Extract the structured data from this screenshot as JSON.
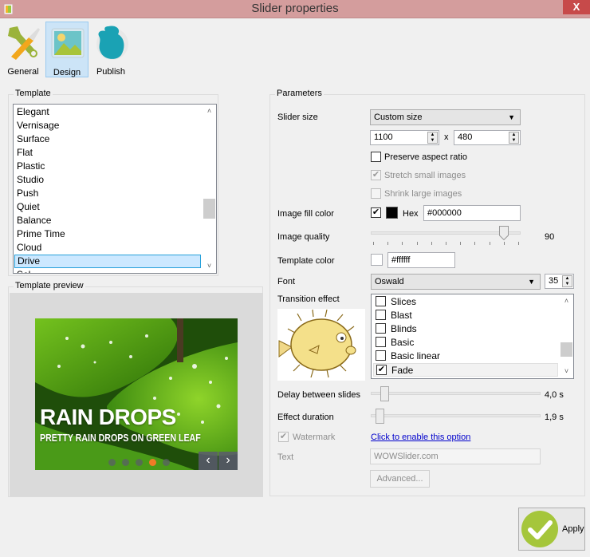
{
  "window": {
    "title": "Slider properties",
    "close_label": "X"
  },
  "toolbar": {
    "buttons": [
      {
        "label": "General",
        "icon": "wrench-icon",
        "active": false
      },
      {
        "label": "Design",
        "icon": "image-icon",
        "active": true
      },
      {
        "label": "Publish",
        "icon": "publish-icon",
        "active": false
      }
    ]
  },
  "template_group": {
    "title": "Template",
    "items": [
      "Elegant",
      "Vernisage",
      "Surface",
      "Flat",
      "Plastic",
      "Studio",
      "Push",
      "Quiet",
      "Balance",
      "Prime Time",
      "Cloud",
      "Drive",
      "Sol"
    ],
    "selected": "Drive",
    "scroll_up": "˄",
    "scroll_down": "˅"
  },
  "preview_group": {
    "title": "Template preview",
    "headline": "RAIN DROPS",
    "subtitle": "PRETTY RAIN DROPS ON GREEN LEAF",
    "dots_count": 5,
    "active_dot": 4,
    "prev_label": "‹",
    "next_label": "›",
    "colors": {
      "active_dot": "#f07b26"
    }
  },
  "parameters": {
    "title": "Parameters",
    "slider_size": {
      "label": "Slider size",
      "selected": "Custom size",
      "width": "1100",
      "times": "x",
      "height": "480"
    },
    "preserve_aspect": {
      "label": "Preserve aspect ratio",
      "checked": false
    },
    "stretch_small": {
      "label": "Stretch small images",
      "checked": true,
      "disabled": true
    },
    "shrink_large": {
      "label": "Shrink large images",
      "checked": false,
      "disabled": true
    },
    "image_fill": {
      "label": "Image fill color",
      "checked": true,
      "hex_label": "Hex",
      "hex_value": "#000000",
      "swatch": "#000000"
    },
    "image_quality": {
      "label": "Image quality",
      "value": 90,
      "value_text": "90",
      "min": 0,
      "max": 100
    },
    "template_color": {
      "label": "Template color",
      "value": "#ffffff",
      "swatch": "#ffffff"
    },
    "font": {
      "label": "Font",
      "selected": "Oswald",
      "size": "35"
    },
    "transition": {
      "label": "Transition effect",
      "items": [
        {
          "label": "Slices",
          "checked": false
        },
        {
          "label": "Blast",
          "checked": false
        },
        {
          "label": "Blinds",
          "checked": false
        },
        {
          "label": "Basic",
          "checked": false
        },
        {
          "label": "Basic linear",
          "checked": false
        },
        {
          "label": "Fade",
          "checked": true
        }
      ]
    },
    "delay": {
      "label": "Delay between slides",
      "value_text": "4,0 s",
      "fraction": 0.03
    },
    "duration": {
      "label": "Effect duration",
      "value_text": "1,9 s",
      "fraction": 0.0
    },
    "watermark": {
      "label": "Watermark",
      "checked": true,
      "disabled": true,
      "link": "Click to enable this option"
    },
    "text": {
      "label": "Text",
      "value": "WOWSlider.com"
    },
    "advanced_label": "Advanced..."
  },
  "apply_label": "Apply"
}
